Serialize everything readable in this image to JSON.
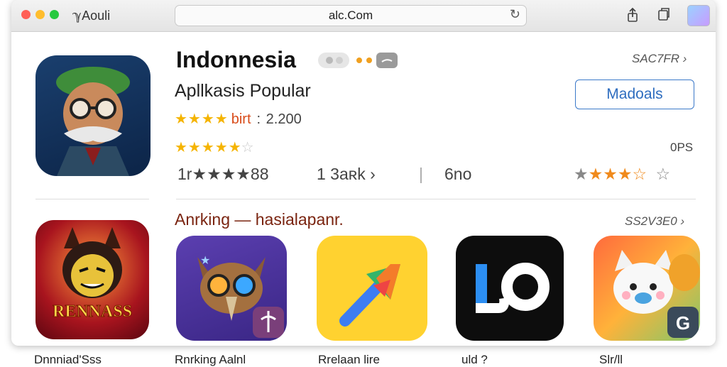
{
  "window": {
    "app_title": "ℽAouli",
    "address": "alc.Com"
  },
  "app": {
    "name": "Indonnesia",
    "subtitle": "Apllkasis Popular",
    "rating_stars": 4,
    "rating_label": "birt",
    "rating_sep": ":",
    "rating_count": "2.200",
    "rating2_stars": 4.5,
    "see_all": "SAC7FR",
    "get_button": "Madoals",
    "size_label": "0PS",
    "stats": {
      "item1": "1r★★★★88",
      "item2": "1 3aʀk",
      "item3": "6no"
    },
    "rating3_stars": 3.5
  },
  "section": {
    "title": "Anrking — hasialapanr.",
    "see_all": "SS2V3E0",
    "apps": [
      {
        "name": "Dnnniad'Sss",
        "icon": "villain-game-icon",
        "icon_text": "RENNASS"
      },
      {
        "name": "Rnrking Aalnl",
        "icon": "owl-game-icon",
        "icon_text": ""
      },
      {
        "name": "Rrelaan lire",
        "icon": "arrow-app-icon",
        "icon_text": ""
      },
      {
        "name": "uld ?",
        "icon": "lo-app-icon",
        "icon_text": "LO"
      },
      {
        "name": "Slr/ll",
        "icon": "animal-game-icon",
        "icon_text": "G"
      }
    ]
  },
  "colors": {
    "accent": "#2e6dbf",
    "star": "#f5b400",
    "star_orange": "#f08a1c",
    "section_title": "#7a2410"
  }
}
